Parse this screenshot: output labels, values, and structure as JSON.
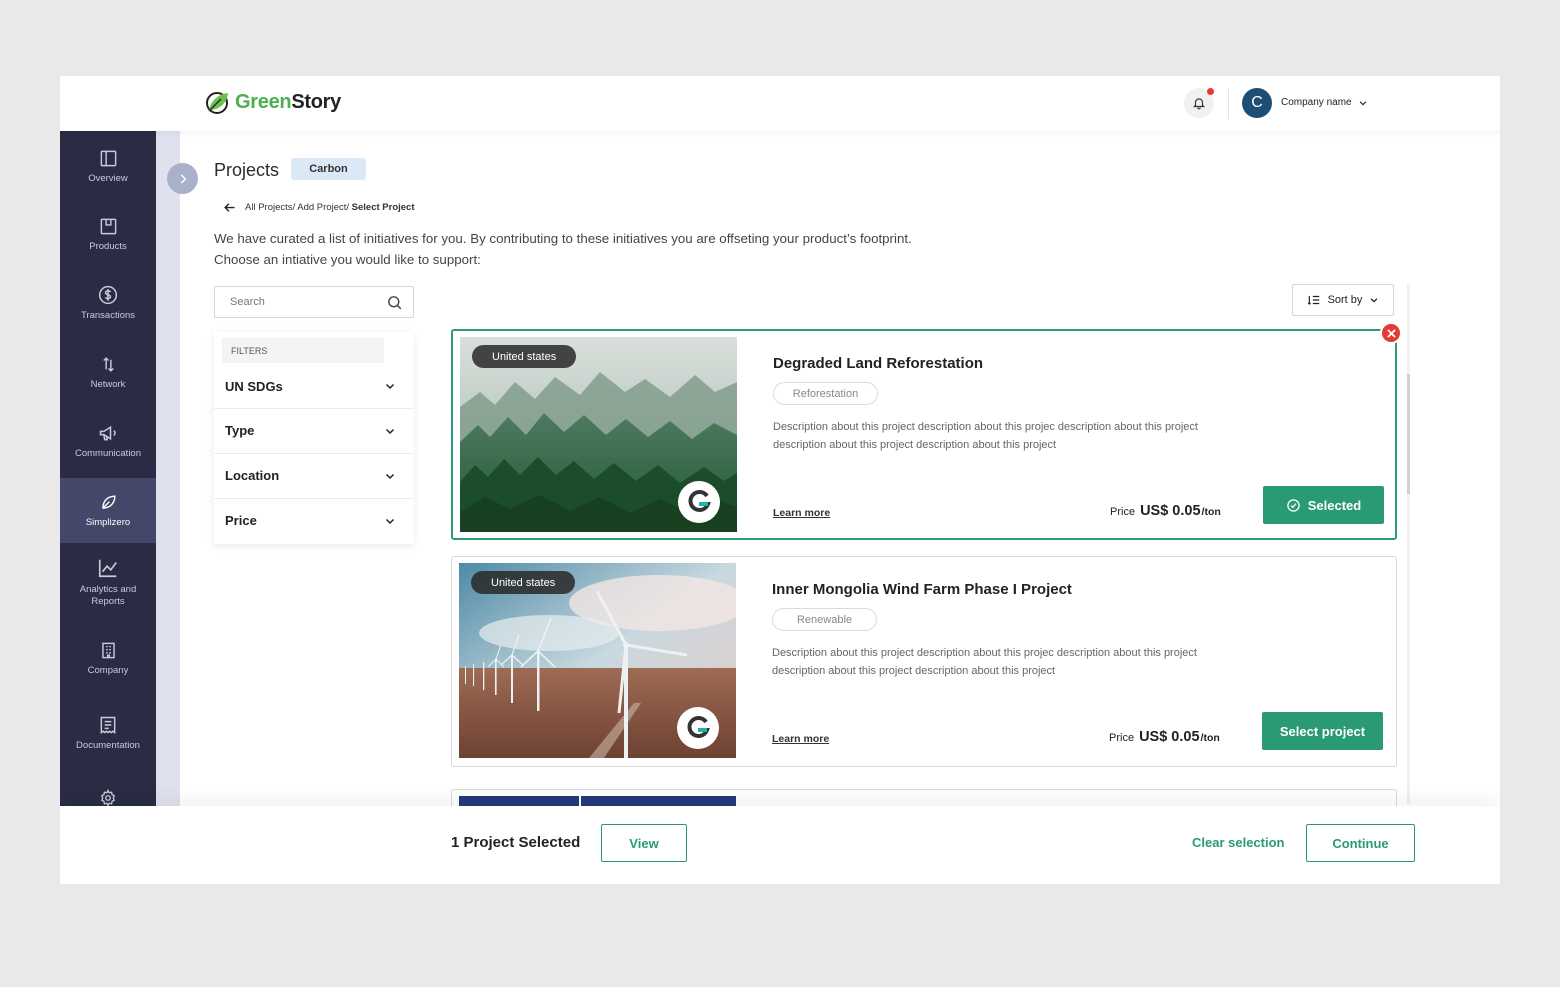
{
  "header": {
    "brand_green": "Green",
    "brand_dark": "Story",
    "company_name": "Company name",
    "avatar_initial": "C"
  },
  "sidebar": {
    "items": [
      {
        "label": "Overview",
        "icon": "overview-icon"
      },
      {
        "label": "Products",
        "icon": "products-icon"
      },
      {
        "label": "Transactions",
        "icon": "dollar-icon"
      },
      {
        "label": "Network",
        "icon": "network-icon"
      },
      {
        "label": "Communication",
        "icon": "megaphone-icon"
      },
      {
        "label": "Simplizero",
        "icon": "leaf-icon",
        "active": true
      },
      {
        "label": "Analytics and",
        "label2": "Reports",
        "icon": "chart-icon"
      },
      {
        "label": "Company",
        "icon": "building-icon"
      },
      {
        "label": "Documentation",
        "icon": "document-icon"
      }
    ]
  },
  "page": {
    "title": "Projects",
    "badge": "Carbon",
    "breadcrumb": {
      "path": "All Projects/ Add Project/ ",
      "current": "Select Project"
    },
    "intro_line1": "We have curated a list of initiatives for you. By contributing to these initiatives you are offseting your product’s footprint.",
    "intro_line2": "Choose an intiative you would like to support:"
  },
  "search": {
    "placeholder": "Search"
  },
  "filters": {
    "heading": "FILTERS",
    "items": [
      "UN SDGs",
      "Type",
      "Location",
      "Price"
    ]
  },
  "sort": {
    "label": "Sort by"
  },
  "projects": [
    {
      "location": "United states",
      "title": "Degraded Land Reforestation",
      "tag": "Reforestation",
      "description": "Description about this project description about this projec description about this project description about this project description about this project",
      "learn_more": "Learn more",
      "price_label": "Price",
      "price": "US$ 0.05",
      "unit": "/ton",
      "button": "Selected",
      "selected": true
    },
    {
      "location": "United states",
      "title": "Inner Mongolia Wind Farm Phase I Project",
      "tag": "Renewable",
      "description": "Description about this project description about this projec description about this project description about this project description about this project",
      "learn_more": "Learn more",
      "price_label": "Price",
      "price": "US$ 0.05",
      "unit": "/ton",
      "button": "Select project",
      "selected": false
    }
  ],
  "footer": {
    "selected_count": "1 Project Selected",
    "view": "View",
    "clear": "Clear selection",
    "continue": "Continue"
  },
  "colors": {
    "accent": "#2a9a72",
    "sidebar": "#2a2c45",
    "sidebar_active": "#44476a",
    "danger": "#e53935",
    "badge_bg": "#dbe9f6"
  }
}
